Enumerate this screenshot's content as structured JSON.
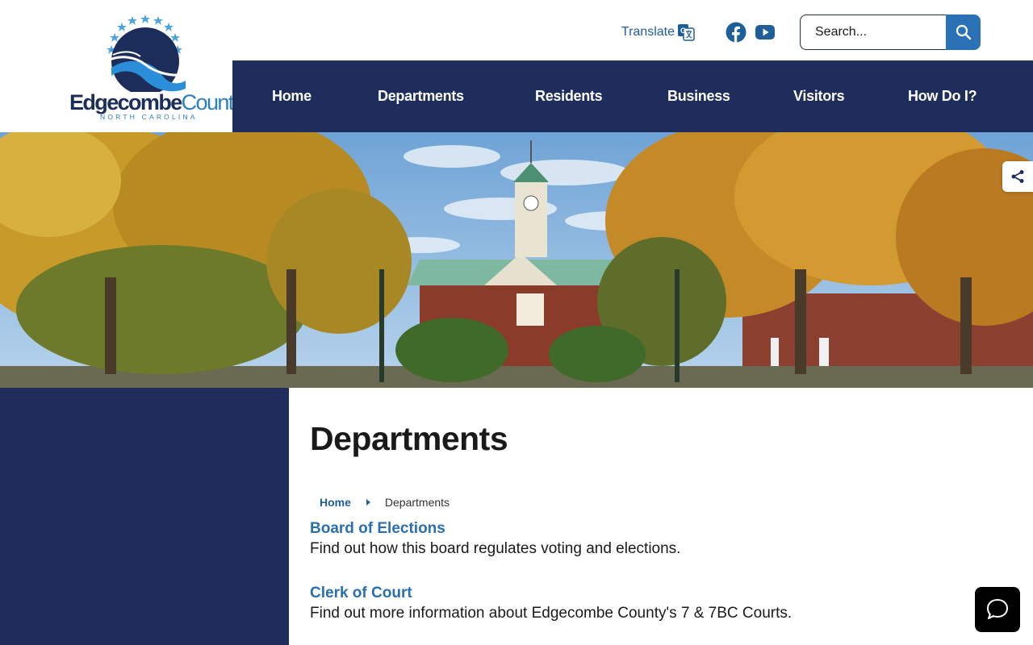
{
  "logo": {
    "name_main": "Edgecombe",
    "name_accent": "County",
    "state": "NORTH CAROLINA"
  },
  "utility": {
    "translate_label": "Translate",
    "search_placeholder": "Search..."
  },
  "nav": {
    "items": [
      {
        "label": "Home"
      },
      {
        "label": "Departments"
      },
      {
        "label": "Residents"
      },
      {
        "label": "Business"
      },
      {
        "label": "Visitors"
      },
      {
        "label": "How Do I?"
      }
    ]
  },
  "page": {
    "title": "Departments"
  },
  "breadcrumb": {
    "home": "Home",
    "current": "Departments"
  },
  "departments": [
    {
      "name": "Board of Elections",
      "description": "Find out how this board regulates voting and elections."
    },
    {
      "name": "Clerk of Court",
      "description": "Find out more information about Edgecombe County's 7 & 7BC Courts."
    }
  ],
  "colors": {
    "navy": "#1f2d5c",
    "link_blue": "#2a6fae",
    "search_button": "#2a72b5"
  },
  "icons": {
    "translate": "google-translate-icon",
    "facebook": "facebook-icon",
    "youtube": "youtube-icon",
    "search": "search-icon",
    "share": "share-icon",
    "chat": "chat-bubble-icon"
  }
}
